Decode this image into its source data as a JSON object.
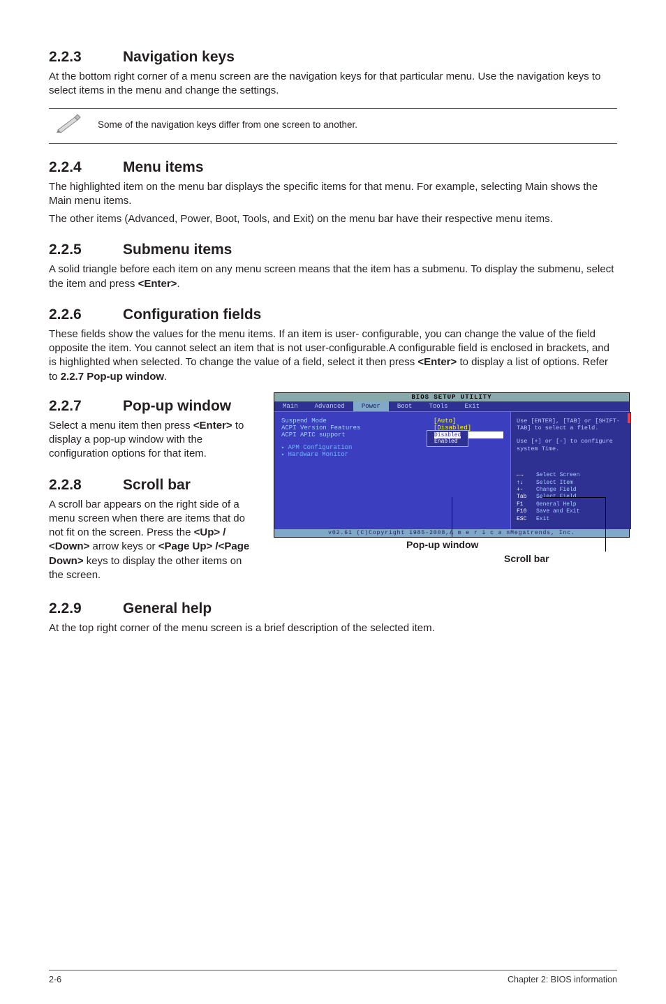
{
  "sections": {
    "s223": {
      "num": "2.2.3",
      "title": "Navigation keys",
      "p1": "At the bottom right corner of a menu screen are the navigation keys for that particular menu. Use the navigation keys to select items in the menu and change the settings."
    },
    "note": "Some of the navigation keys differ from one screen to another.",
    "s224": {
      "num": "2.2.4",
      "title": "Menu items",
      "p1": "The highlighted item on the menu bar displays the specific items for that menu. For example, selecting Main shows the Main menu items.",
      "p2": "The other items (Advanced, Power, Boot, Tools, and Exit) on the menu bar have their respective menu items."
    },
    "s225": {
      "num": "2.2.5",
      "title": "Submenu items",
      "p1_a": "A solid triangle before each item on any menu screen means that the item has a submenu. To display the submenu, select the item and press ",
      "p1_b": "<Enter>",
      "p1_c": "."
    },
    "s226": {
      "num": "2.2.6",
      "title": "Configuration fields",
      "p1_a": "These fields show the values for the menu items. If an item is user- configurable, you can change the value of the field opposite the item. You cannot select an item that is not user-configurable.A configurable field is enclosed in brackets, and is highlighted when selected. To change the value of a field, select it then press ",
      "p1_b": "<Enter>",
      "p1_c": " to display a list of options. Refer to ",
      "p1_d": "2.2.7 Pop-up window",
      "p1_e": "."
    },
    "s227": {
      "num": "2.2.7",
      "title": "Pop-up window",
      "p1_a": "Select a menu item then press ",
      "p1_b": "<Enter>",
      "p1_c": " to display a pop-up window with the configuration options for that item."
    },
    "s228": {
      "num": "2.2.8",
      "title": "Scroll bar",
      "p1_a": "A scroll bar appears on the right side of a menu screen when there are items that do not fit on the screen. Press the ",
      "p1_b": "<Up> / <Down>",
      "p1_c": " arrow keys or ",
      "p1_d": "<Page Up> /<Page Down>",
      "p1_e": " keys to display the other items on the screen."
    },
    "s229": {
      "num": "2.2.9",
      "title": "General help",
      "p1": "At the top right corner of the menu screen is a brief description of the selected item."
    }
  },
  "bios": {
    "title": "BIOS SETUP UTILITY",
    "menus": {
      "m1": "Main",
      "m2": "Advanced",
      "m3": "Power",
      "m4": "Boot",
      "m5": "Tools",
      "m6": "Exit"
    },
    "rows": {
      "r1l": "Suspend Mode",
      "r1v": "[Auto]",
      "r2l": "ACPI Version Features",
      "r2v": "[Disabled]",
      "r3l": "ACPI APIC support",
      "r3v": "[Enabled]"
    },
    "subs": {
      "s1": "APM Configuration",
      "s2": "Hardware Monitor"
    },
    "popup": {
      "opt1": "Disabled",
      "opt2": "Enabled"
    },
    "help": {
      "l1": "Use [ENTER], [TAB] or [SHIFT-TAB] to select a field.",
      "l2": "Use [+] or [-] to configure system Time."
    },
    "keys": {
      "k1": "←→",
      "v1": "Select Screen",
      "k2": "↑↓",
      "v2": "Select Item",
      "k3": "+-",
      "v3": "Change Field",
      "k4": "Tab",
      "v4": "Select Field",
      "k5": "F1",
      "v5": "General Help",
      "k6": "F10",
      "v6": "Save and Exit",
      "k7": "ESC",
      "v7": "Exit"
    },
    "footer": "v02.61 (C)Copyright 1985-2008,A m e r i c a nMegatrends, Inc."
  },
  "callouts": {
    "popup": "Pop-up window",
    "scroll": "Scroll bar"
  },
  "footer": {
    "left": "2-6",
    "right": "Chapter 2: BIOS information"
  }
}
